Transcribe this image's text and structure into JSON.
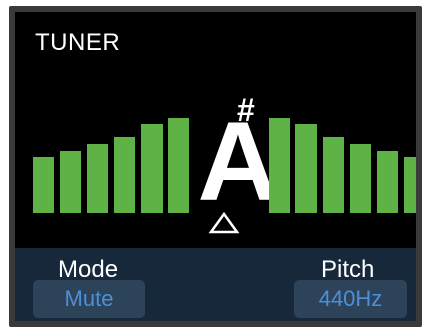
{
  "title": "TUNER",
  "tuner": {
    "note": "A",
    "accidental": "#",
    "deviation": 0,
    "left_bars_lit": 6,
    "right_bars_lit": 6,
    "bar_color": "#5fb346",
    "pointer_icon": "triangle-up-outline-icon"
  },
  "controls": {
    "mode": {
      "label": "Mode",
      "value": "Mute"
    },
    "pitch": {
      "label": "Pitch",
      "value": "440Hz"
    },
    "panel_color": "#16283a",
    "button_color": "#2d4359",
    "value_color": "#4d8fd6"
  }
}
